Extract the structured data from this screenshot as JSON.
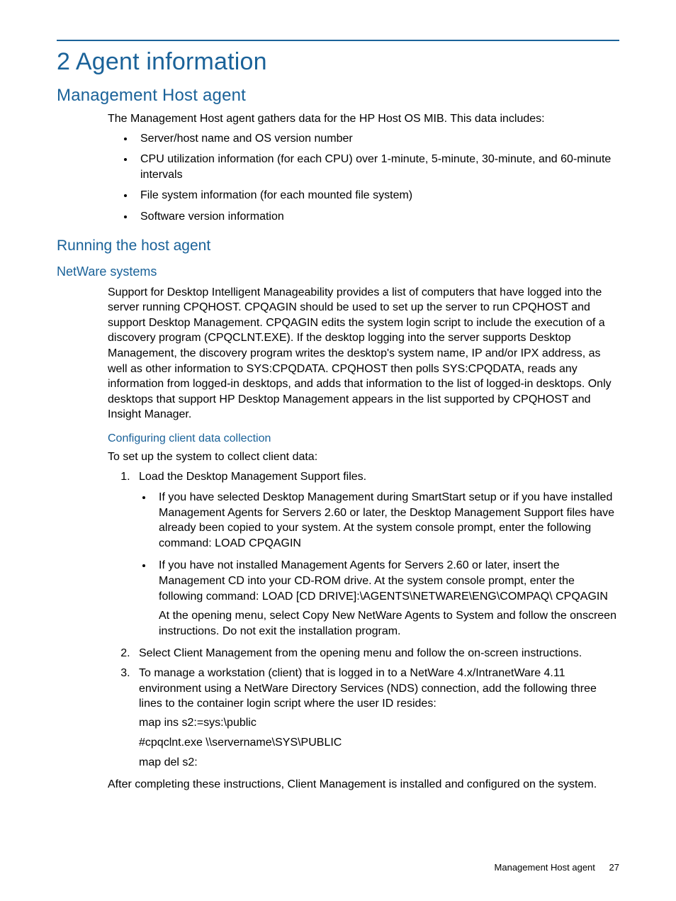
{
  "chapter_title": "2 Agent information",
  "section1": {
    "title": "Management Host agent",
    "intro": "The Management Host agent gathers data for the HP Host OS MIB. This data includes:",
    "bullets": [
      "Server/host name and OS version number",
      "CPU utilization information (for each CPU) over 1-minute, 5-minute, 30-minute, and 60-minute intervals",
      "File system information (for each mounted file system)",
      "Software version information"
    ]
  },
  "section2": {
    "title": "Running the host agent",
    "sub1": {
      "title": "NetWare systems",
      "para": "Support for Desktop Intelligent Manageability provides a list of computers that have logged into the server running CPQHOST. CPQAGIN should be used to set up the server to run CPQHOST and support Desktop Management. CPQAGIN edits the system login script to include the execution of a discovery program (CPQCLNT.EXE). If the desktop logging into the server supports Desktop Management, the discovery program writes the desktop's system name, IP and/or IPX address, as well as other information to SYS:CPQDATA. CPQHOST then polls SYS:CPQDATA, reads any information from logged-in desktops, and adds that information to the list of logged-in desktops. Only desktops that support HP Desktop Management appears in the list supported by CPQHOST and Insight Manager."
    },
    "sub2": {
      "title": "Configuring client data collection",
      "intro": "To set up the system to collect client data:",
      "steps": {
        "1": "Load the Desktop Management Support files.",
        "1_bullets": {
          "a": "If you have selected Desktop Management during SmartStart setup or if you have installed Management Agents for Servers 2.60 or later, the Desktop Management Support files have already been copied to your system. At the system console prompt, enter the following command: LOAD CPQAGIN",
          "b": "If you have not installed Management Agents for Servers 2.60 or later, insert the Management CD into your CD-ROM drive. At the system console prompt, enter the following command: LOAD [CD DRIVE]:\\AGENTS\\NETWARE\\ENG\\COMPAQ\\ CPQAGIN",
          "b_note": "At the opening menu, select Copy New NetWare Agents to System and follow the onscreen instructions. Do not exit the installation program."
        },
        "2": "Select Client Management from the opening menu and follow the on-screen instructions.",
        "3": "To manage a workstation (client) that is logged in to a NetWare 4.x/IntranetWare 4.11 environment using a NetWare Directory Services (NDS) connection, add the following three lines to the container login script where the user ID resides:",
        "3_code": {
          "l1": "map ins s2:=sys:\\public",
          "l2": "#cpqclnt.exe \\\\servername\\SYS\\PUBLIC",
          "l3": "map del s2:"
        }
      },
      "closing": "After completing these instructions, Client Management is installed and configured on the system."
    }
  },
  "footer": {
    "section": "Management Host agent",
    "page": "27"
  }
}
